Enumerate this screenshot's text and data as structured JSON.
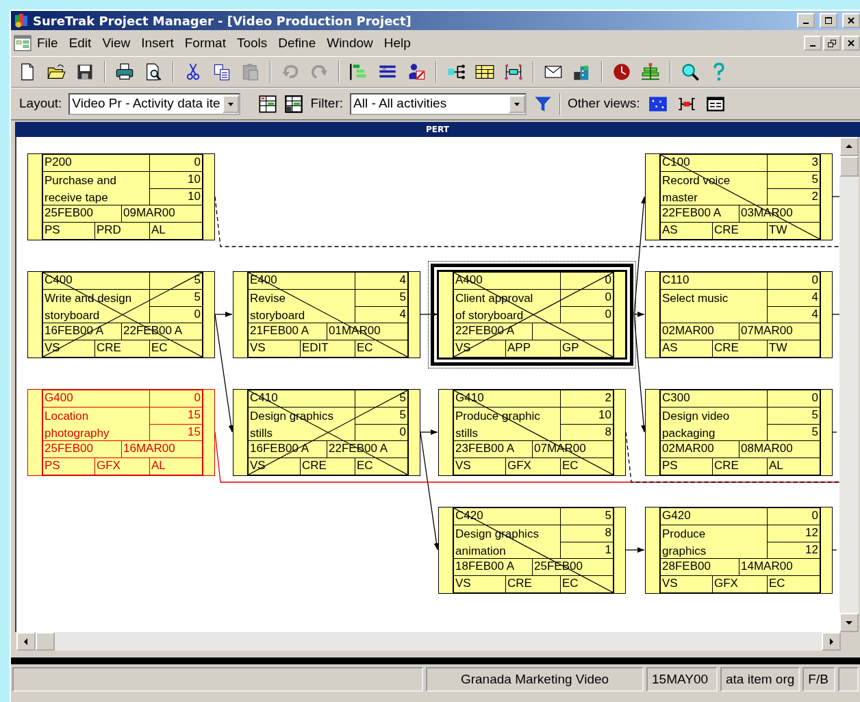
{
  "window": {
    "title": "SureTrak Project Manager - [Video Production Project]"
  },
  "menu": [
    {
      "label": "File"
    },
    {
      "label": "Edit"
    },
    {
      "label": "View"
    },
    {
      "label": "Insert"
    },
    {
      "label": "Format"
    },
    {
      "label": "Tools"
    },
    {
      "label": "Define"
    },
    {
      "label": "Window"
    },
    {
      "label": "Help"
    }
  ],
  "layout_bar": {
    "layout_label": "Layout:",
    "layout_value": "Video Pr - Activity data ite",
    "filter_label": "Filter:",
    "filter_value": "All - All activities",
    "other_views_label": "Other views:"
  },
  "view": {
    "title": "PERT"
  },
  "nodes": [
    {
      "code": "P200",
      "name_lines": [
        "Purchase and",
        "receive tape"
      ],
      "numbers": [
        "0",
        "10",
        "10"
      ],
      "start": "25FEB00",
      "finish": "09MAR00",
      "resources": [
        "PS",
        "PRD",
        "AL"
      ],
      "started": false,
      "finished": false,
      "critical": false,
      "selected": false
    },
    {
      "code": "C100",
      "name_lines": [
        "Record voice",
        "master"
      ],
      "numbers": [
        "3",
        "5",
        "2"
      ],
      "start": "22FEB00 A",
      "finish": "03MAR00",
      "resources": [
        "AS",
        "CRE",
        "TW"
      ],
      "started": true,
      "finished": false,
      "critical": false,
      "selected": false
    },
    {
      "code": "C400",
      "name_lines": [
        "Write and design",
        "storyboard"
      ],
      "numbers": [
        "5",
        "5",
        "0"
      ],
      "start": "16FEB00 A",
      "finish": "22FEB00 A",
      "resources": [
        "VS",
        "CRE",
        "EC"
      ],
      "started": true,
      "finished": true,
      "critical": false,
      "selected": false
    },
    {
      "code": "E400",
      "name_lines": [
        "Revise",
        "storyboard"
      ],
      "numbers": [
        "4",
        "5",
        "4"
      ],
      "start": "21FEB00 A",
      "finish": "01MAR00",
      "resources": [
        "VS",
        "EDIT",
        "EC"
      ],
      "started": true,
      "finished": false,
      "critical": false,
      "selected": false
    },
    {
      "code": "A400",
      "name_lines": [
        "Client approval",
        "of storyboard"
      ],
      "numbers": [
        "0",
        "0",
        "0"
      ],
      "start": "22FEB00 A",
      "resources": [
        "VS",
        "APP",
        "GP"
      ],
      "started": true,
      "finished": true,
      "critical": false,
      "selected": true
    },
    {
      "code": "C110",
      "name_lines": [
        "Select music"
      ],
      "numbers": [
        "0",
        "4",
        "4"
      ],
      "start": "02MAR00",
      "finish": "07MAR00",
      "resources": [
        "AS",
        "CRE",
        "TW"
      ],
      "started": false,
      "finished": false,
      "critical": false,
      "selected": false
    },
    {
      "code": "G400",
      "name_lines": [
        "Location",
        "photography"
      ],
      "numbers": [
        "0",
        "15",
        "15"
      ],
      "start": "25FEB00",
      "finish": "16MAR00",
      "resources": [
        "PS",
        "GFX",
        "AL"
      ],
      "started": false,
      "finished": false,
      "critical": true,
      "selected": false
    },
    {
      "code": "C410",
      "name_lines": [
        "Design graphics",
        "stills"
      ],
      "numbers": [
        "5",
        "5",
        "0"
      ],
      "start": "16FEB00 A",
      "finish": "22FEB00 A",
      "resources": [
        "VS",
        "CRE",
        "EC"
      ],
      "started": true,
      "finished": true,
      "critical": false,
      "selected": false
    },
    {
      "code": "G410",
      "name_lines": [
        "Produce graphic",
        "stills"
      ],
      "numbers": [
        "2",
        "10",
        "8"
      ],
      "start": "23FEB00 A",
      "finish": "07MAR00",
      "resources": [
        "VS",
        "GFX",
        "EC"
      ],
      "started": true,
      "finished": false,
      "critical": false,
      "selected": false
    },
    {
      "code": "C300",
      "name_lines": [
        "Design video",
        "packaging"
      ],
      "numbers": [
        "0",
        "5",
        "5"
      ],
      "start": "02MAR00",
      "finish": "08MAR00",
      "resources": [
        "PS",
        "CRE",
        "AL"
      ],
      "started": false,
      "finished": false,
      "critical": false,
      "selected": false
    },
    {
      "code": "C420",
      "name_lines": [
        "Design graphics",
        "animation"
      ],
      "numbers": [
        "5",
        "8",
        "1"
      ],
      "start": "18FEB00 A",
      "finish": "25FEB00",
      "resources": [
        "VS",
        "CRE",
        "EC"
      ],
      "started": true,
      "finished": false,
      "critical": false,
      "selected": false
    },
    {
      "code": "G420",
      "name_lines": [
        "Produce",
        "graphics"
      ],
      "numbers": [
        "0",
        "12",
        "12"
      ],
      "start": "28FEB00",
      "finish": "14MAR00",
      "resources": [
        "VS",
        "GFX",
        "EC"
      ],
      "started": false,
      "finished": false,
      "critical": false,
      "selected": false
    }
  ],
  "status_bar": [
    "Granada Marketing Video",
    "15MAY00",
    "ata item org",
    "F/B"
  ]
}
